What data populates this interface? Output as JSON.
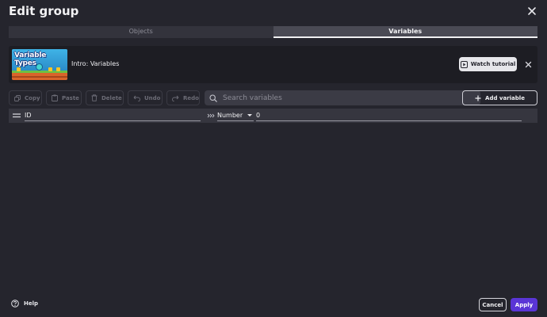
{
  "dialog": {
    "title": "Edit group"
  },
  "tabs": [
    {
      "label": "Objects",
      "active": false
    },
    {
      "label": "Variables",
      "active": true
    }
  ],
  "tutorial": {
    "thumbnail_title": "Variable Types",
    "label": "Intro: Variables",
    "watch_label": "Watch tutorial"
  },
  "toolbar": {
    "copy_label": "Copy",
    "paste_label": "Paste",
    "delete_label": "Delete",
    "undo_label": "Undo",
    "redo_label": "Redo",
    "search_placeholder": "Search variables",
    "add_label": "Add variable"
  },
  "variables": [
    {
      "name": "ID",
      "type": "Number",
      "value": "0"
    }
  ],
  "footer": {
    "help_label": "Help",
    "cancel_label": "Cancel",
    "apply_label": "Apply"
  },
  "colors": {
    "background": "#25252d",
    "accent": "#5a35d6"
  }
}
